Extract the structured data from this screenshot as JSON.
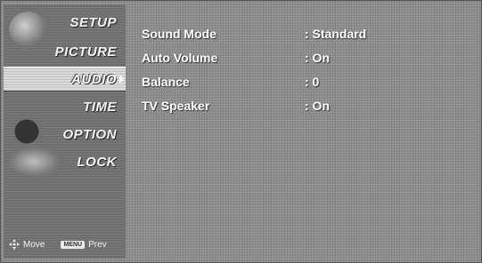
{
  "menu": {
    "items": [
      {
        "label": "SETUP"
      },
      {
        "label": "PICTURE"
      },
      {
        "label": "AUDIO"
      },
      {
        "label": "TIME"
      },
      {
        "label": "OPTION"
      },
      {
        "label": "LOCK"
      }
    ],
    "selected_index": 2
  },
  "footer": {
    "move_label": "Move",
    "menu_key_label": "MENU",
    "prev_label": "Prev"
  },
  "settings": [
    {
      "name": "Sound Mode",
      "value": ": Standard"
    },
    {
      "name": "Auto Volume",
      "value": ": On"
    },
    {
      "name": "Balance",
      "value": ": 0"
    },
    {
      "name": "TV Speaker",
      "value": ": On"
    }
  ],
  "colors": {
    "background": "#8c8c8c",
    "sidebar": "#6e6e6e",
    "selected": "#d9d9d9",
    "text": "#ffffff"
  }
}
